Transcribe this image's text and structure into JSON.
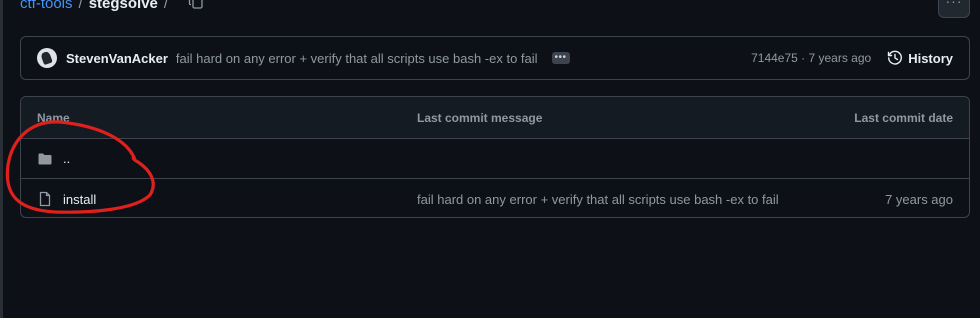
{
  "breadcrumb": {
    "repo": "ctf-tools",
    "separator": "/",
    "folder": "stegsolve",
    "trailing_separator": "/"
  },
  "icons": {
    "copy": "copy-icon",
    "more": "kebab-horizontal-icon",
    "avatar": "user-avatar",
    "ellipsis": "ellipsis-icon",
    "history": "history-icon",
    "folder": "folder-icon",
    "file": "file-icon"
  },
  "more_button": {
    "label": "···"
  },
  "commit": {
    "author": "StevenVanAcker",
    "message": "fail hard on any error + verify that all scripts use bash -ex to fail",
    "ellipsis": "•••",
    "meta": "7144e75 · 7 years ago",
    "history_label": "History"
  },
  "table": {
    "headers": {
      "name": "Name",
      "message": "Last commit message",
      "date": "Last commit date"
    },
    "rows": [
      {
        "type": "folder",
        "name": "..",
        "message": "",
        "date": ""
      },
      {
        "type": "file",
        "name": "install",
        "message": "fail hard on any error + verify that all scripts use bash -ex to fail",
        "date": "7 years ago"
      }
    ]
  },
  "colors": {
    "background": "#0d1117",
    "border": "#3d444d",
    "link": "#4493f8",
    "muted": "#9198a1",
    "text": "#e6edf3",
    "annotation": "#e0201c"
  }
}
